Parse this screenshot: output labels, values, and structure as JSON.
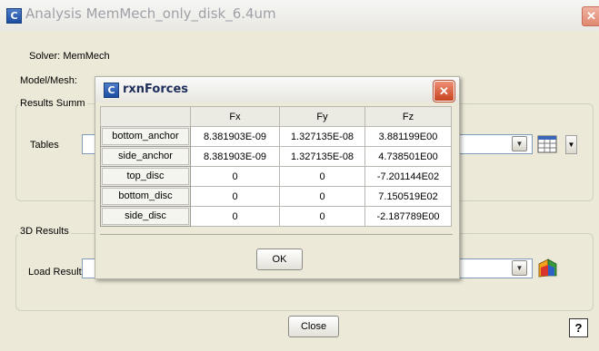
{
  "main_window": {
    "title": "Analysis MemMech_only_disk_6.4um",
    "close_glyph": "✕",
    "app_icon_letter": "C",
    "solver_label": "Solver:",
    "solver_value": "MemMech",
    "model_mesh_label": "Model/Mesh:",
    "results_summary_title": "Results Summ",
    "tables_label": "Tables",
    "results3d_title": "3D Results",
    "load_result_label": "Load Result",
    "close_button": "Close",
    "help_glyph": "?"
  },
  "dialog": {
    "title": "rxnForces",
    "app_icon_letter": "C",
    "close_glyph": "✕",
    "ok_button": "OK",
    "table": {
      "columns": [
        "",
        "Fx",
        "Fy",
        "Fz"
      ],
      "rows": [
        {
          "name": "bottom_anchor",
          "fx": "8.381903E-09",
          "fy": "1.327135E-08",
          "fz": "3.881199E00"
        },
        {
          "name": "side_anchor",
          "fx": "8.381903E-09",
          "fy": "1.327135E-08",
          "fz": "4.738501E00"
        },
        {
          "name": "top_disc",
          "fx": "0",
          "fy": "0",
          "fz": "-7.201144E02"
        },
        {
          "name": "bottom_disc",
          "fx": "0",
          "fy": "0",
          "fz": "7.150519E02"
        },
        {
          "name": "side_disc",
          "fx": "0",
          "fy": "0",
          "fz": "-2.187789E00"
        }
      ]
    }
  },
  "icons": {
    "dropdown": "▼",
    "table_icon": "table-icon",
    "load_icon": "3d-result-icon"
  }
}
